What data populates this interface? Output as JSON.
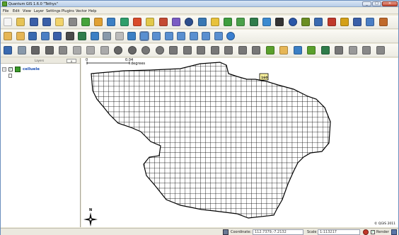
{
  "window": {
    "title": "Quantum GIS 1.6.0 \"Tethys\"",
    "minimize_label": "_",
    "maximize_label": "□",
    "close_label": "✕"
  },
  "menu": [
    "File",
    "Edit",
    "View",
    "Layer",
    "Settings",
    "Plugins",
    "Vector",
    "Help"
  ],
  "toolbars": {
    "row1": [
      {
        "name": "new-project-icon",
        "color": "#f5f5f5"
      },
      {
        "name": "open-project-icon",
        "color": "#e6c355"
      },
      {
        "name": "save-project-icon",
        "color": "#3a5fa8"
      },
      {
        "name": "save-as-icon",
        "color": "#3a5fa8"
      },
      {
        "name": "print-composer-icon",
        "color": "#f2d36b"
      },
      {
        "name": "print-icon",
        "color": "#888888"
      },
      {
        "name": "add-vector-layer-icon",
        "color": "#45a33a"
      },
      {
        "name": "add-raster-layer-icon",
        "color": "#e0a133"
      },
      {
        "name": "add-postgis-layer-icon",
        "color": "#3b7fc4"
      },
      {
        "name": "add-spatialite-layer-icon",
        "color": "#2e9e6b"
      },
      {
        "name": "add-wms-layer-icon",
        "color": "#d94b2b"
      },
      {
        "name": "new-vector-layer-icon",
        "color": "#e2c84a"
      },
      {
        "name": "remove-layer-icon",
        "color": "#c44a33"
      },
      {
        "name": "add-wfs-layer-icon",
        "color": "#7a5cc4"
      },
      {
        "name": "options-icon",
        "color": "#2d4f8e"
      },
      {
        "name": "python-console-icon",
        "color": "#3877b3"
      },
      {
        "name": "plugin-yellow-icon",
        "color": "#e8c23a"
      },
      {
        "name": "plugin-green-icon",
        "color": "#3e9e3e"
      },
      {
        "name": "plugin-grass-icon",
        "color": "#4aa04a"
      },
      {
        "name": "plugin-table-icon",
        "color": "#2f7c4a"
      },
      {
        "name": "plugin-globe-icon",
        "color": "#3b8ad0"
      },
      {
        "name": "plugin-chart-icon",
        "color": "#333333"
      },
      {
        "name": "plugin-compass-icon",
        "color": "#2a57a8"
      },
      {
        "name": "plugin-gear-icon",
        "color": "#6b8e23"
      },
      {
        "name": "plugin-edit-icon",
        "color": "#3a6ab0"
      },
      {
        "name": "plugin-pdf-icon",
        "color": "#c0392b"
      },
      {
        "name": "plugin-pen-icon",
        "color": "#d4a017"
      },
      {
        "name": "plugin-line-icon",
        "color": "#3a5fa8"
      },
      {
        "name": "plugin-db-icon",
        "color": "#4a7ec4"
      },
      {
        "name": "plugin-brush-icon",
        "color": "#c06a2a"
      }
    ],
    "row2": [
      {
        "name": "pan-map-icon",
        "color": "#e6b655"
      },
      {
        "name": "select-feature-icon",
        "color": "#e6b655"
      },
      {
        "name": "open-table-icon",
        "color": "#3a6ab0"
      },
      {
        "name": "field-calculator-icon",
        "color": "#4a7ec4"
      },
      {
        "name": "attribute-table-icon",
        "color": "#3a5fa8"
      },
      {
        "name": "query-icon",
        "color": "#4a4a4a"
      },
      {
        "name": "measure-icon",
        "color": "#2f7c4a"
      },
      {
        "name": "label-icon",
        "color": "#3b7fc4"
      },
      {
        "name": "bookmark-icon",
        "color": "#8899aa"
      },
      {
        "name": "map-tips-icon",
        "color": "#bbbbbb"
      },
      {
        "name": "identify-icon",
        "color": "#3b7fc4"
      },
      {
        "name": "zoom-in-icon",
        "color": "#5a8fd0"
      },
      {
        "name": "zoom-out-icon",
        "color": "#5a8fd0"
      },
      {
        "name": "zoom-full-icon",
        "color": "#5a8fd0"
      },
      {
        "name": "zoom-layer-icon",
        "color": "#5a8fd0"
      },
      {
        "name": "zoom-selection-icon",
        "color": "#5a8fd0"
      },
      {
        "name": "zoom-last-icon",
        "color": "#5a8fd0"
      },
      {
        "name": "zoom-next-icon",
        "color": "#5a8fd0"
      },
      {
        "name": "refresh-icon",
        "color": "#3a7fd0"
      }
    ],
    "row3": [
      {
        "name": "toggle-editing-icon",
        "color": "#3a6ab0"
      },
      {
        "name": "save-edits-icon",
        "color": "#8899aa"
      },
      {
        "name": "add-point-icon",
        "color": "#666666"
      },
      {
        "name": "add-line-icon",
        "color": "#666666"
      },
      {
        "name": "add-polygon-icon",
        "color": "#888888"
      },
      {
        "name": "move-feature-icon",
        "color": "#aaaaaa"
      },
      {
        "name": "node-tool-icon",
        "color": "#aaaaaa"
      },
      {
        "name": "delete-selected-icon",
        "color": "#aaaaaa"
      },
      {
        "name": "undo-icon",
        "color": "#666666"
      },
      {
        "name": "redo-icon",
        "color": "#666666"
      },
      {
        "name": "simplify-icon",
        "color": "#777777"
      },
      {
        "name": "add-ring-icon",
        "color": "#777777"
      },
      {
        "name": "add-part-icon",
        "color": "#777777"
      },
      {
        "name": "delete-ring-icon",
        "color": "#777777"
      },
      {
        "name": "delete-part-icon",
        "color": "#777777"
      },
      {
        "name": "reshape-icon",
        "color": "#777777"
      },
      {
        "name": "split-icon",
        "color": "#777777"
      },
      {
        "name": "merge-icon",
        "color": "#777777"
      },
      {
        "name": "rotate-icon",
        "color": "#777777"
      },
      {
        "name": "annotation-icon",
        "color": "#5aa02c"
      },
      {
        "name": "text-annotation-icon",
        "color": "#e6b655"
      },
      {
        "name": "form-annotation-icon",
        "color": "#3b7fc4"
      },
      {
        "name": "offset-curve-icon",
        "color": "#5aa02c"
      },
      {
        "name": "fill-ring-icon",
        "color": "#2f7c4a"
      },
      {
        "name": "digitize-icon",
        "color": "#777777"
      },
      {
        "name": "vertex-icon",
        "color": "#999999"
      },
      {
        "name": "snap-icon",
        "color": "#888888"
      },
      {
        "name": "gps-icon",
        "color": "#888888"
      }
    ]
  },
  "layers_panel": {
    "title": "Layers",
    "close_label": "x",
    "layers": [
      {
        "name": "celluele",
        "checked": "✓",
        "expand": "−"
      }
    ]
  },
  "map": {
    "scalebar": {
      "start_label": "0",
      "end_label": "0.04",
      "unit": "degrees"
    },
    "highlight_label": "160",
    "north_label": "N",
    "copyright": "© QGIS 2011",
    "cell_fill": "#ffffff",
    "cell_stroke": "#111111"
  },
  "status": {
    "coordinate_label": "Coordinate:",
    "coordinate_value": "112.7379,-7.2132",
    "scale_label": "Scale",
    "scale_value": "1:113217",
    "render_label": "Render",
    "render_checked": "✓"
  }
}
